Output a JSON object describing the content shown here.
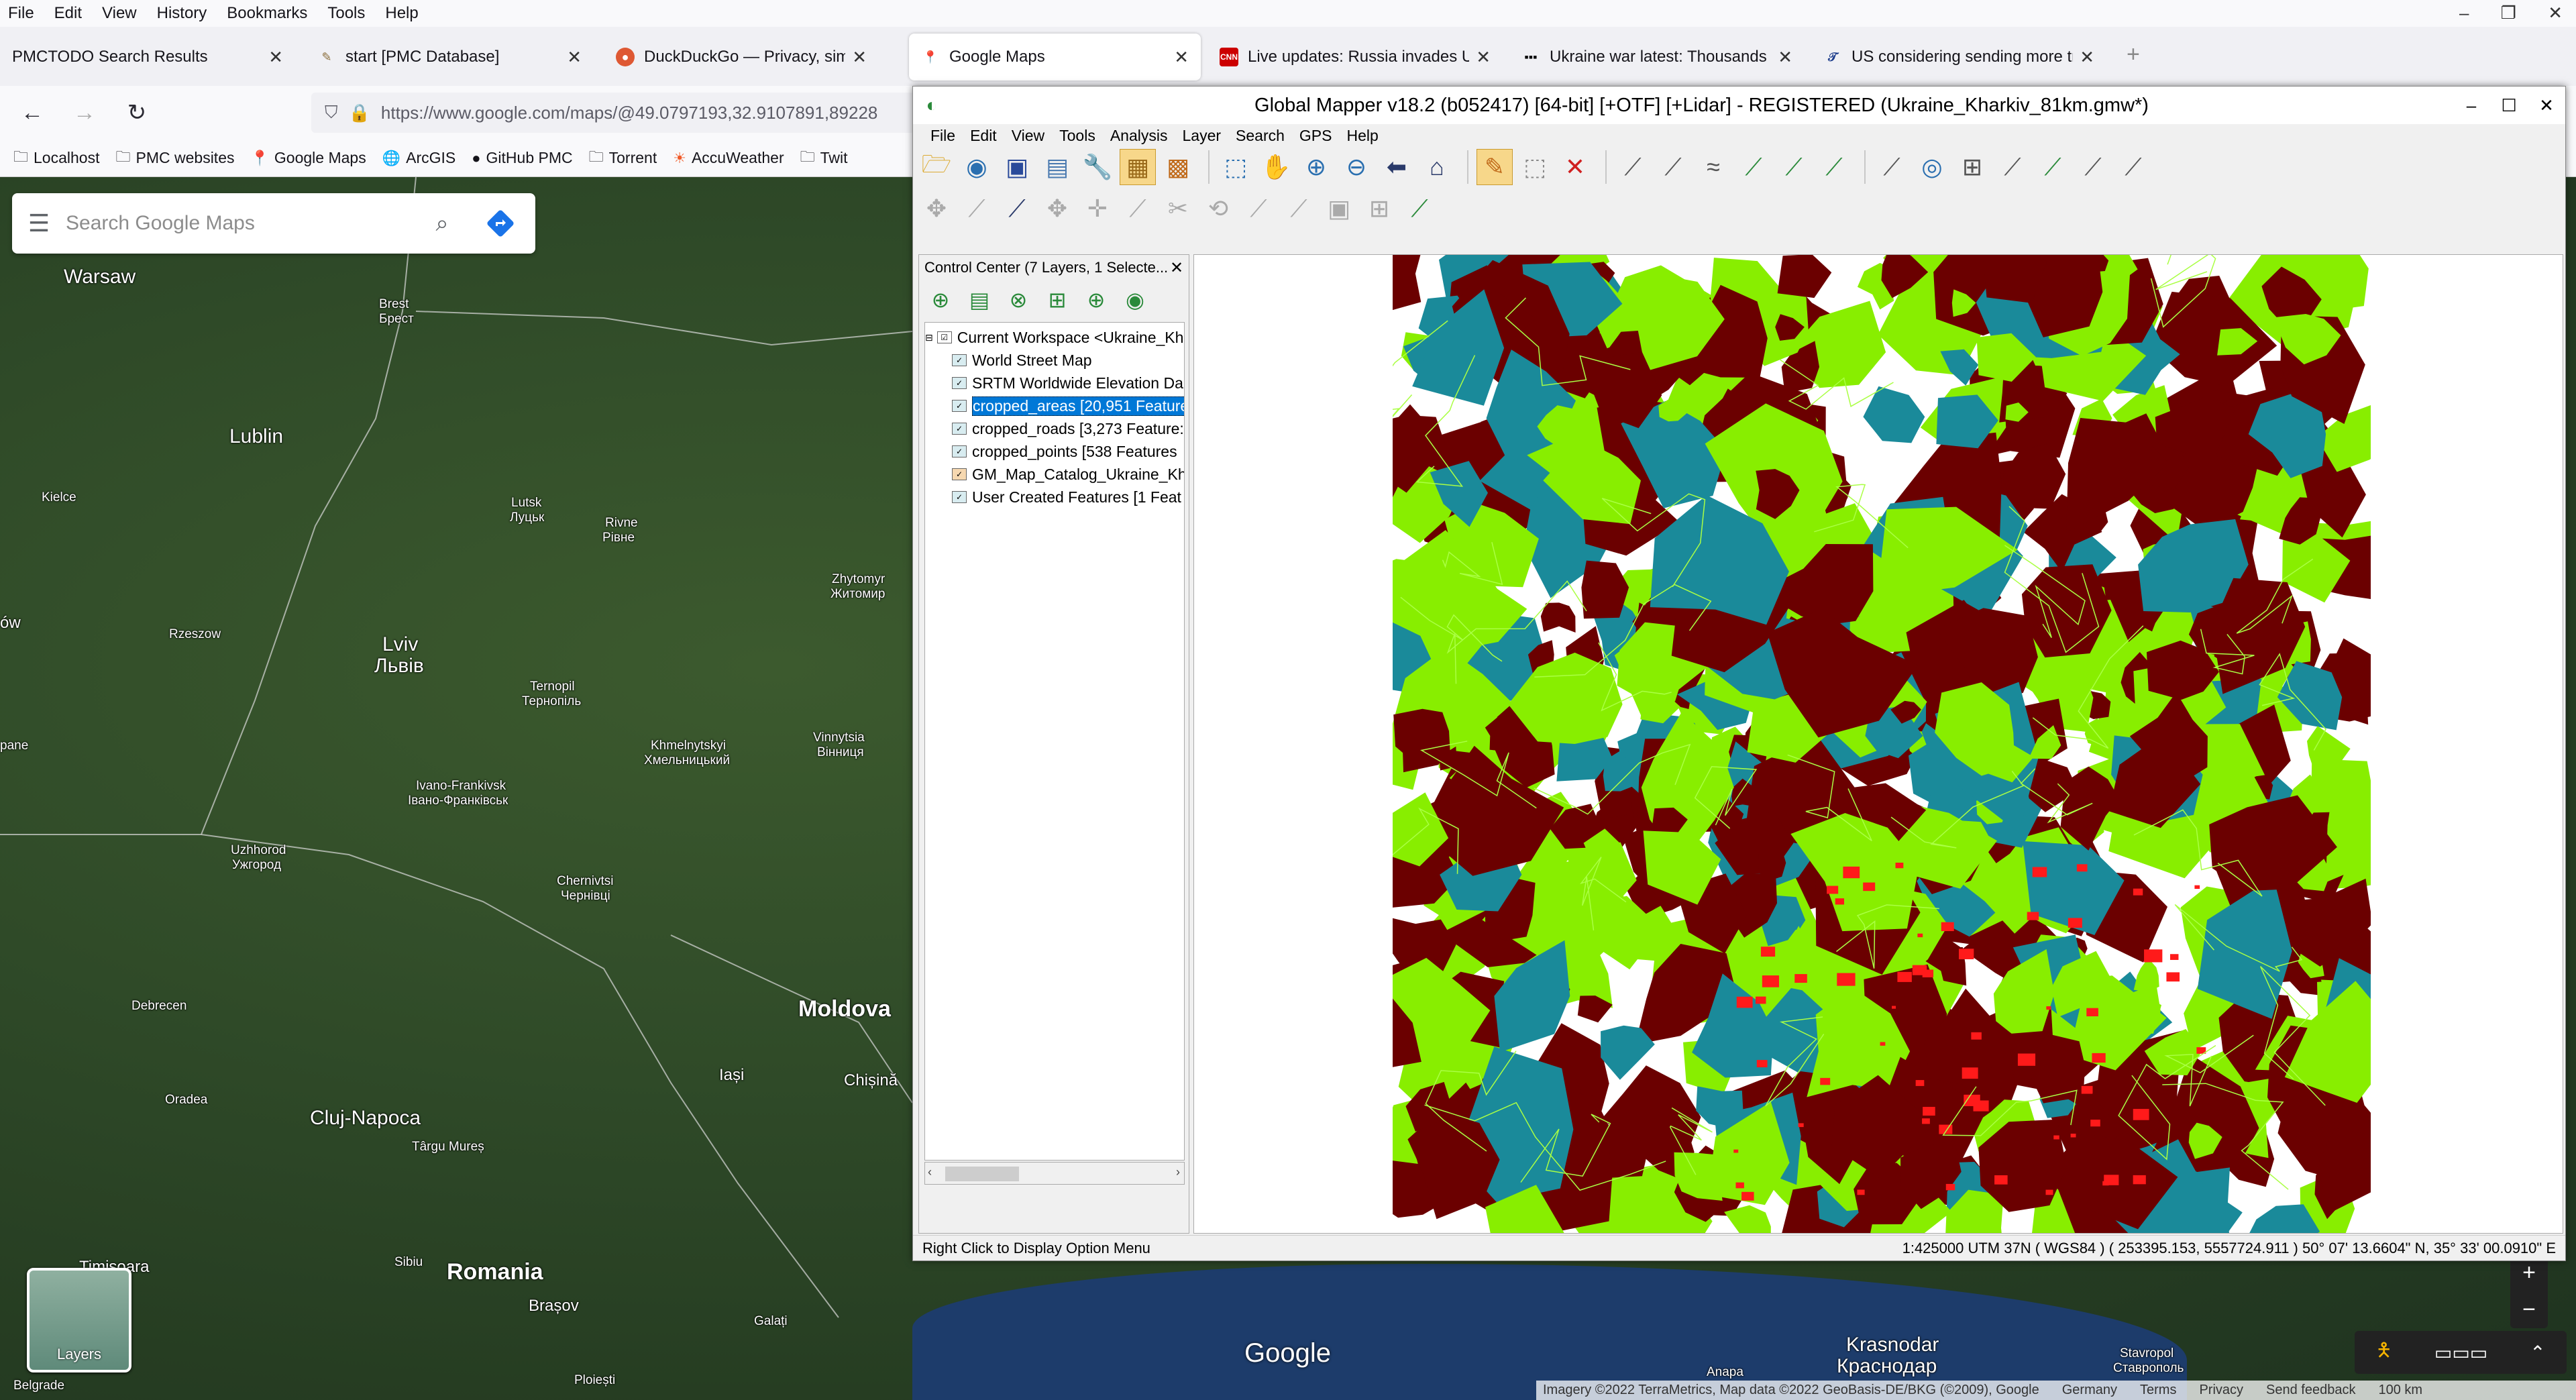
{
  "browser": {
    "menu": [
      "File",
      "Edit",
      "View",
      "History",
      "Bookmarks",
      "Tools",
      "Help"
    ],
    "tabs": [
      {
        "title": "PMCTODO Search Results",
        "icon": "blank-page-icon",
        "active": false
      },
      {
        "title": "start [PMC Database]",
        "icon": "wiki-icon",
        "active": false
      },
      {
        "title": "DuckDuckGo — Privacy, simplifi",
        "icon": "duckduckgo-icon",
        "active": false
      },
      {
        "title": "Google Maps",
        "icon": "google-maps-icon",
        "active": true
      },
      {
        "title": "Live updates: Russia invades Uk",
        "icon": "cnn-icon",
        "active": false
      },
      {
        "title": "Ukraine war latest: Thousands t",
        "icon": "news-icon",
        "active": false
      },
      {
        "title": "US considering sending more tr",
        "icon": "nyt-icon",
        "active": false
      }
    ],
    "url": "https://www.google.com/maps/@49.0797193,32.9107891,89228",
    "bookmarks": [
      {
        "label": "Localhost",
        "icon": "folder-icon"
      },
      {
        "label": "PMC websites",
        "icon": "folder-icon"
      },
      {
        "label": "Google Maps",
        "icon": "google-maps-icon"
      },
      {
        "label": "ArcGIS",
        "icon": "globe-icon"
      },
      {
        "label": "GitHub PMC",
        "icon": "github-icon"
      },
      {
        "label": "Torrent",
        "icon": "folder-icon"
      },
      {
        "label": "AccuWeather",
        "icon": "weather-icon"
      },
      {
        "label": "Twit",
        "icon": "folder-icon"
      }
    ]
  },
  "gmaps": {
    "search_placeholder": "Search Google Maps",
    "layers_label": "Layers",
    "logo": "Google",
    "attribution": [
      "Imagery ©2022 TerraMetrics, Map data ©2022 GeoBasis-DE/BKG (©2009), Google",
      "Germany",
      "Terms",
      "Privacy",
      "Send feedback",
      "100 km"
    ],
    "labels": {
      "warsaw": "Warsaw",
      "brest": "Brest",
      "brest_cyr": "Брест",
      "lublin": "Lublin",
      "kielce": "Kielce",
      "lutsk": "Lutsk",
      "lutsk_cyr": "Луцьк",
      "rivne": "Rivne",
      "rivne_cyr": "Рівне",
      "zhytomyr": "Zhytomyr",
      "zhytomyr_cyr": "Житомир",
      "rzeszow": "Rzeszow",
      "low": "ów",
      "lviv": "Lviv",
      "lviv_cyr": "Львів",
      "ternopil": "Ternopil",
      "ternopil_cyr": "Тернопіль",
      "khmelnytskyi": "Khmelnytskyi",
      "khmelnytskyi_cyr": "Хмельницький",
      "vinnytsia": "Vinnytsia",
      "vinnytsia_cyr": "Вінниця",
      "pane": "pane",
      "ivano": "Ivano-Frankivsk",
      "ivano_cyr": "Івано-Франківськ",
      "uzhhorod": "Uzhhorod",
      "uzhhorod_cyr": "Ужгород",
      "chernivtsi": "Chernivtsi",
      "chernivtsi_cyr": "Чернівці",
      "debrecen": "Debrecen",
      "moldova": "Moldova",
      "oradea": "Oradea",
      "cluj": "Cluj-Napoca",
      "iasi": "Iași",
      "chisina": "Chișină",
      "targu": "Târgu Mureș",
      "timisoara": "Timisoara",
      "sibiu": "Sibiu",
      "romania": "Romania",
      "brasov": "Brașov",
      "galati": "Galați",
      "belgrade": "Belgrade",
      "ploiesti": "Ploiești",
      "krasnodar": "Krasnodar",
      "krasnodar_cyr": "Краснодар",
      "anapa": "Anapa",
      "stavropol": "Stavropol",
      "stavropol_cyr": "Ставрополь"
    }
  },
  "globalmapper": {
    "title": "Global Mapper v18.2 (b052417) [64-bit] [+OTF] [+Lidar] - REGISTERED (Ukraine_Kharkiv_81km.gmw*)",
    "menu": [
      "File",
      "Edit",
      "View",
      "Tools",
      "Analysis",
      "Layer",
      "Search",
      "GPS",
      "Help"
    ],
    "control_center_title": "Control Center (7 Layers, 1 Selecte...",
    "workspace": "Current Workspace <Ukraine_Kh",
    "layers": [
      {
        "label": "World Street Map",
        "selected": false
      },
      {
        "label": "SRTM Worldwide Elevation Da",
        "selected": false
      },
      {
        "label": "cropped_areas [20,951 Feature",
        "selected": true
      },
      {
        "label": "cropped_roads [3,273 Feature:",
        "selected": false
      },
      {
        "label": "cropped_points [538 Features",
        "selected": false
      },
      {
        "label": "GM_Map_Catalog_Ukraine_Kh",
        "selected": false
      },
      {
        "label": "User Created Features [1 Feat",
        "selected": false
      }
    ],
    "status_left": "Right Click to Display Option Menu",
    "status_right": "1:425000 UTM 37N ( WGS84 ) ( 253395.153, 5557724.911 ) 50° 07' 13.6604\" N, 35° 33' 00.0910\" E",
    "colors": {
      "forest": "#6b0000",
      "meadow": "#88ee00",
      "water": "#1a8a9a",
      "urban": "#ff1a1a",
      "road": "#aaff44"
    }
  }
}
